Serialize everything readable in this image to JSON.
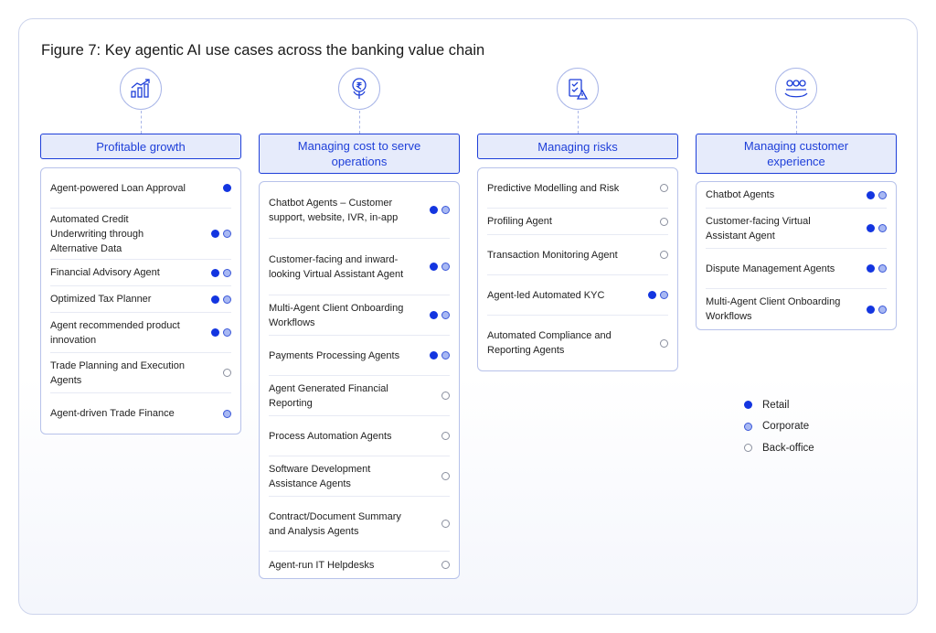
{
  "title": "Figure 7: Key agentic AI use cases across the banking value chain",
  "colors": {
    "accent": "#1e3fd9",
    "header_bg": "#e6ebfb",
    "retail": "#1335e0",
    "corporate": "#a8b8f3",
    "back_office": "#ffffff"
  },
  "columns": [
    {
      "icon": "growth-chart-icon",
      "header": "Profitable growth",
      "items": [
        {
          "label": "Agent-powered Loan Approval",
          "tags": [
            "retail"
          ]
        },
        {
          "label": "Automated Credit Underwriting through Alternative Data",
          "tags": [
            "retail",
            "corporate"
          ]
        },
        {
          "label": "Financial Advisory Agent",
          "tags": [
            "retail",
            "corporate"
          ]
        },
        {
          "label": "Optimized Tax Planner",
          "tags": [
            "retail",
            "corporate"
          ]
        },
        {
          "label": "Agent recommended product innovation",
          "tags": [
            "retail",
            "corporate"
          ]
        },
        {
          "label": "Trade Planning and Execution Agents",
          "tags": [
            "back"
          ]
        },
        {
          "label": "Agent-driven Trade Finance",
          "tags": [
            "corporate"
          ]
        }
      ]
    },
    {
      "icon": "money-tree-icon",
      "header": "Managing cost to serve operations",
      "items": [
        {
          "label": "Chatbot Agents – Customer support, website, IVR, in-app",
          "tags": [
            "retail",
            "corporate"
          ]
        },
        {
          "label": "Customer-facing and inward-looking Virtual Assistant Agent",
          "tags": [
            "retail",
            "corporate"
          ]
        },
        {
          "label": "Multi-Agent Client Onboarding Workflows",
          "tags": [
            "retail",
            "corporate"
          ]
        },
        {
          "label": "Payments Processing Agents",
          "tags": [
            "retail",
            "corporate"
          ]
        },
        {
          "label": "Agent Generated Financial Reporting",
          "tags": [
            "back"
          ]
        },
        {
          "label": "Process Automation Agents",
          "tags": [
            "back"
          ]
        },
        {
          "label": "Software Development Assistance Agents",
          "tags": [
            "back"
          ]
        },
        {
          "label": "Contract/Document Summary and Analysis Agents",
          "tags": [
            "back"
          ]
        },
        {
          "label": "Agent-run IT Helpdesks",
          "tags": [
            "back"
          ]
        }
      ]
    },
    {
      "icon": "checklist-warning-icon",
      "header": "Managing risks",
      "items": [
        {
          "label": "Predictive Modelling and Risk",
          "tags": [
            "back"
          ]
        },
        {
          "label": "Profiling Agent",
          "tags": [
            "back"
          ]
        },
        {
          "label": "Transaction Monitoring Agent",
          "tags": [
            "back"
          ]
        },
        {
          "label": "Agent-led Automated KYC",
          "tags": [
            "retail",
            "corporate"
          ]
        },
        {
          "label": "Automated Compliance and Reporting Agents",
          "tags": [
            "back"
          ]
        }
      ]
    },
    {
      "icon": "people-group-icon",
      "header": "Managing customer experience",
      "items": [
        {
          "label": "Chatbot Agents",
          "tags": [
            "retail",
            "corporate"
          ]
        },
        {
          "label": "Customer-facing Virtual Assistant Agent",
          "tags": [
            "retail",
            "corporate"
          ]
        },
        {
          "label": "Dispute Management Agents",
          "tags": [
            "retail",
            "corporate"
          ]
        },
        {
          "label": "Multi-Agent Client Onboarding Workflows",
          "tags": [
            "retail",
            "corporate"
          ]
        }
      ]
    }
  ],
  "legend": [
    {
      "key": "retail",
      "label": "Retail"
    },
    {
      "key": "corporate",
      "label": "Corporate"
    },
    {
      "key": "back",
      "label": "Back-office"
    }
  ]
}
